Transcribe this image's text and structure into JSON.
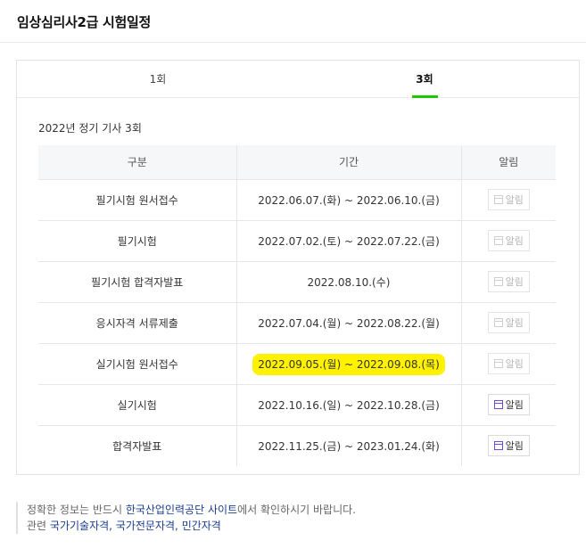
{
  "page": {
    "title": "임상심리사2급 시험일정"
  },
  "tabs": [
    {
      "label": "1회",
      "active": false
    },
    {
      "label": "3회",
      "active": true
    }
  ],
  "section": {
    "title": "2022년 정기 기사 3회"
  },
  "table": {
    "headers": [
      "구분",
      "기간",
      "알림"
    ],
    "rows": [
      {
        "category": "필기시험 원서접수",
        "period": "2022.06.07.(화) ~ 2022.06.10.(금)",
        "alarm": "알림",
        "alarm_active": false,
        "highlighted": false
      },
      {
        "category": "필기시험",
        "period": "2022.07.02.(토) ~ 2022.07.22.(금)",
        "alarm": "알림",
        "alarm_active": false,
        "highlighted": false
      },
      {
        "category": "필기시험 합격자발표",
        "period": "2022.08.10.(수)",
        "alarm": "알림",
        "alarm_active": false,
        "highlighted": false
      },
      {
        "category": "응시자격 서류제출",
        "period": "2022.07.04.(월) ~ 2022.08.22.(월)",
        "alarm": "알림",
        "alarm_active": false,
        "highlighted": false
      },
      {
        "category": "실기시험 원서접수",
        "period": "2022.09.05.(월) ~ 2022.09.08.(목)",
        "alarm": "알림",
        "alarm_active": false,
        "highlighted": true
      },
      {
        "category": "실기시험",
        "period": "2022.10.16.(일) ~ 2022.10.28.(금)",
        "alarm": "알림",
        "alarm_active": true,
        "highlighted": false
      },
      {
        "category": "합격자발표",
        "period": "2022.11.25.(금) ~ 2023.01.24.(화)",
        "alarm": "알림",
        "alarm_active": true,
        "highlighted": false
      }
    ]
  },
  "notice": {
    "text_before": "정확한 정보는 반드시 ",
    "link": "한국산업인력공단 사이트",
    "text_after": "에서 확인하시기 바랍니다.",
    "related_label": "관련 ",
    "related_links": [
      "국가기술자격",
      "국가전문자격",
      "민간자격"
    ],
    "separator": ", "
  },
  "colors": {
    "active_tab_underline": "#1ec800",
    "highlight": "#fff200",
    "link": "#1a3e8c",
    "active_alarm_icon": "#6d4bd6"
  }
}
